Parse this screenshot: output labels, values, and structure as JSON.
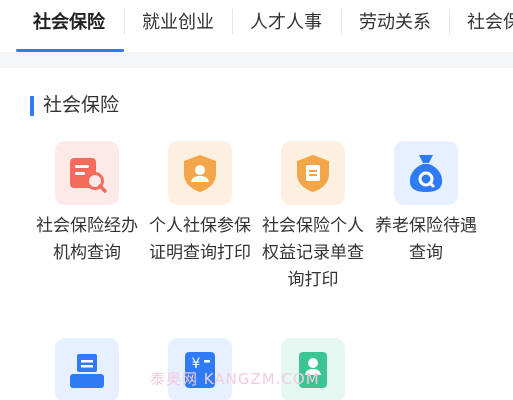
{
  "tabs": [
    {
      "label": "社会保险",
      "active": true
    },
    {
      "label": "就业创业",
      "active": false
    },
    {
      "label": "人才人事",
      "active": false
    },
    {
      "label": "劳动关系",
      "active": false
    },
    {
      "label": "社会保",
      "active": false
    }
  ],
  "section": {
    "title": "社会保险"
  },
  "services": [
    {
      "label": "社会保险经办机构查询",
      "icon": "document-search-icon",
      "bg": "#fde9e7",
      "color": "#f46a5b"
    },
    {
      "label": "个人社保参保证明查询打印",
      "icon": "shield-person-icon",
      "bg": "#fdf0e1",
      "color": "#f3a54a"
    },
    {
      "label": "社会保险个人权益记录单查询打印",
      "icon": "shield-document-icon",
      "bg": "#fdf0e1",
      "color": "#f3a54a"
    },
    {
      "label": "养老保险待遇查询",
      "icon": "money-bag-icon",
      "bg": "#e6f0fe",
      "color": "#2f7bf5"
    },
    {
      "label": "",
      "icon": "printer-icon",
      "bg": "#e6f0fe",
      "color": "#2f7bf5"
    },
    {
      "label": "",
      "icon": "yuan-card-icon",
      "bg": "#e6f0fe",
      "color": "#2f7bf5"
    },
    {
      "label": "",
      "icon": "certificate-person-icon",
      "bg": "#e4f7f1",
      "color": "#3cc592"
    }
  ],
  "watermark": "泰奥网 KANGZM.COM"
}
